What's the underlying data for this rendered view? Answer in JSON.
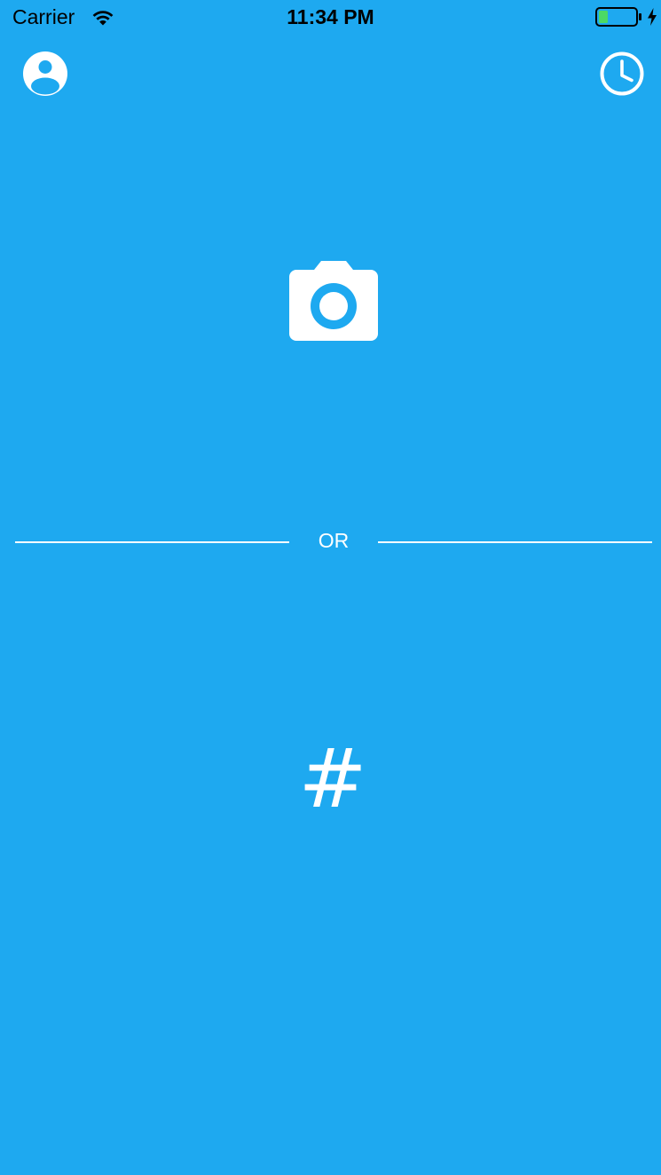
{
  "status_bar": {
    "carrier": "Carrier",
    "time": "11:34 PM"
  },
  "icons": {
    "wifi": "wifi-icon",
    "battery": "battery-icon",
    "charging": "charging-icon",
    "profile": "user-circle-icon",
    "history": "clock-icon",
    "camera": "camera-icon"
  },
  "main": {
    "divider_text": "OR",
    "hash_label": "#"
  },
  "colors": {
    "background": "#1EA9F0",
    "foreground": "#FFFFFF",
    "battery_fill": "#4CD964"
  }
}
